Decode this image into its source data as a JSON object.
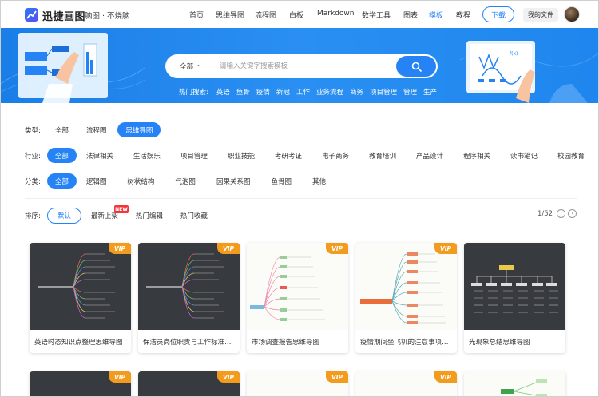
{
  "nav": {
    "brand": "迅捷画图",
    "slogan": "脑图 · 不烧脑",
    "links": [
      {
        "label": "首页",
        "active": false
      },
      {
        "label": "思维导图",
        "active": false
      },
      {
        "label": "流程图",
        "active": false
      },
      {
        "label": "白板",
        "active": false
      },
      {
        "label": "Markdown",
        "active": false
      },
      {
        "label": "数学工具",
        "active": false
      },
      {
        "label": "图表",
        "active": false
      },
      {
        "label": "模板",
        "active": true
      },
      {
        "label": "教程",
        "active": false
      }
    ],
    "download_label": "下载",
    "my_files_label": "我的文件"
  },
  "search": {
    "category": "全部",
    "placeholder": "请输入关键字搜索模板",
    "hot_label": "热门搜索:",
    "hot_keywords": [
      "英语",
      "鱼骨",
      "疫情",
      "新冠",
      "工作",
      "业务流程",
      "商务",
      "项目管理",
      "管理",
      "生产"
    ]
  },
  "filters": {
    "type": {
      "label": "类型:",
      "options": [
        "全部",
        "流程图",
        "思维导图"
      ],
      "active": 2
    },
    "industry": {
      "label": "行业:",
      "options": [
        "全部",
        "法律相关",
        "生活娱乐",
        "项目管理",
        "职业技能",
        "考研考证",
        "电子商务",
        "教育培训",
        "产品设计",
        "程序相关",
        "读书笔记",
        "校园教育"
      ],
      "active": 0
    },
    "category": {
      "label": "分类:",
      "options": [
        "全部",
        "逻辑图",
        "树状结构",
        "气泡图",
        "因果关系图",
        "鱼骨图",
        "其他"
      ],
      "active": 0
    }
  },
  "sort": {
    "label": "排序:",
    "options": [
      "默认",
      "最新上架",
      "热门编辑",
      "热门收藏"
    ],
    "active": 0,
    "new_badge": "NEW",
    "pager": "1/52"
  },
  "cards": [
    {
      "title": "英语时态知识点整理思维导图",
      "vip": "VIP",
      "theme": "dark"
    },
    {
      "title": "保洁员岗位职责与工作标准思…",
      "vip": "VIP",
      "theme": "dark"
    },
    {
      "title": "市场调查报告思维导图",
      "vip": "VIP",
      "theme": "light"
    },
    {
      "title": "疫情期间坐飞机的注意事项思…",
      "vip": "VIP",
      "theme": "light"
    },
    {
      "title": "光现象总结思维导图",
      "vip": "",
      "theme": "dark"
    }
  ],
  "cards_row2_vip": [
    "VIP",
    "VIP",
    "VIP",
    "VIP",
    ""
  ]
}
